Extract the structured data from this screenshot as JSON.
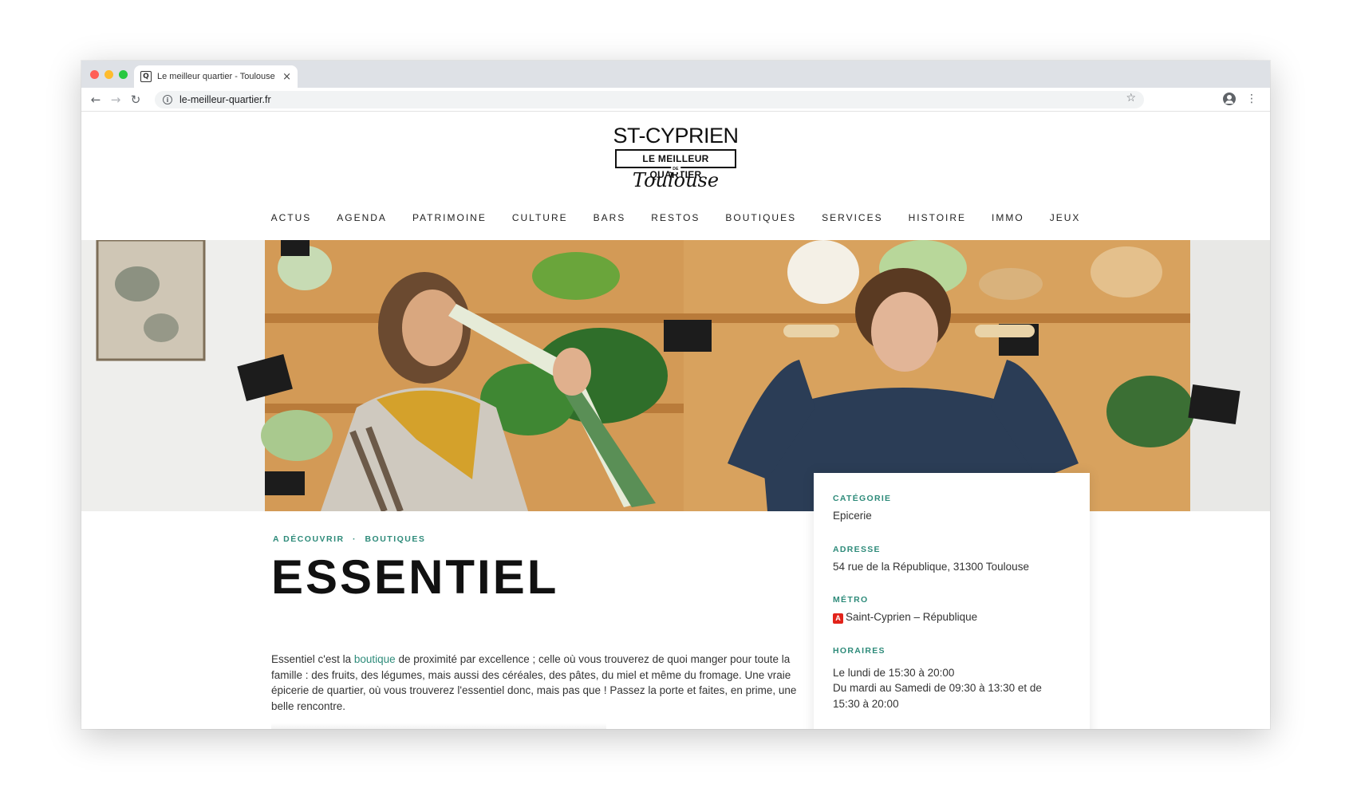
{
  "browser": {
    "tab_title": "Le meilleur quartier - Toulouse",
    "tab_close": "×",
    "url": "le-meilleur-quartier.fr",
    "favicon_letter": "Q",
    "icons": [
      "back-icon",
      "forward-icon",
      "reload-icon",
      "info-icon",
      "star-icon",
      "account-icon",
      "menu-icon"
    ]
  },
  "logo": {
    "top": "ST-CYPRIEN",
    "box": "LE MEILLEUR QUARTIER",
    "de": "DE",
    "script": "Toulouse"
  },
  "nav": [
    "ACTUS",
    "AGENDA",
    "PATRIMOINE",
    "CULTURE",
    "BARS",
    "RESTOS",
    "BOUTIQUES",
    "SERVICES",
    "HISTOIRE",
    "IMMO",
    "JEUX"
  ],
  "article": {
    "breadcrumb": [
      "A DÉCOUVRIR",
      "·",
      "BOUTIQUES"
    ],
    "title": "ESSENTIEL",
    "intro_before": "Essentiel c'est la ",
    "intro_link": "boutique",
    "intro_after": " de proximité par excellence ; celle où vous trouverez de quoi manger pour toute la famille : des fruits, des légumes, mais aussi des céréales, des pâtes, du miel et même du fromage. Une vraie épicerie de quartier, où vous trouverez l'essentiel donc, mais pas que ! Passez la porte et faites, en prime, une belle rencontre."
  },
  "info": {
    "category_label": "CATÉGORIE",
    "category": "Epicerie",
    "address_label": "ADRESSE",
    "address": "54 rue de la République, 31300 Toulouse",
    "metro_label": "MÉTRO",
    "metro_badge": "A",
    "metro": "Saint-Cyprien – République",
    "hours_label": "HORAIRES",
    "hours_1": "Le lundi de 15:30 à 20:00",
    "hours_2": "Du mardi au Samedi de 09:30 à 13:30 et de 15:30 à 20:00"
  },
  "colors": {
    "accent": "#2e8b7a",
    "metro_red": "#e2231a"
  }
}
